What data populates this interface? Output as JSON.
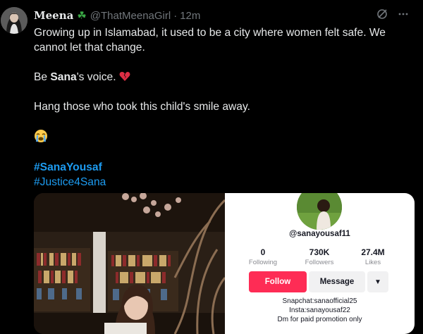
{
  "author": {
    "name": "Meena",
    "emoji": "☘",
    "handle": "@ThatMeenaGirl",
    "separator": "·",
    "time": "12m"
  },
  "tweet": {
    "line1": "Growing up in Islamabad, it used to be a city where women felt safe. We cannot let that change.",
    "line2_prefix": "Be ",
    "line2_bold": "Sana",
    "line2_suffix": "'s voice.",
    "line3": "Hang those who took this child's smile away.",
    "hashtags": [
      "#SanaYousaf",
      "#Justice4Sana"
    ]
  },
  "profile_card": {
    "username": "@sanayousaf11",
    "stats": [
      {
        "value": "0",
        "label": "Following"
      },
      {
        "value": "730K",
        "label": "Followers"
      },
      {
        "value": "27.4M",
        "label": "Likes"
      }
    ],
    "follow_label": "Follow",
    "message_label": "Message",
    "bio": [
      "Snapchat:sanaofficial25",
      "Insta:sanayousaf22",
      "Dm for paid promotion only"
    ]
  },
  "colors": {
    "background": "#000000",
    "text": "#e7e9ea",
    "muted": "#71767b",
    "link": "#1d9bf0",
    "follow": "#fe2c55"
  },
  "icons": {
    "header_a": "grok-icon",
    "header_b": "more-options-icon",
    "heart": "broken-heart-icon",
    "cry": "loudly-crying-face-icon",
    "dropdown": "triangle-down-icon"
  }
}
